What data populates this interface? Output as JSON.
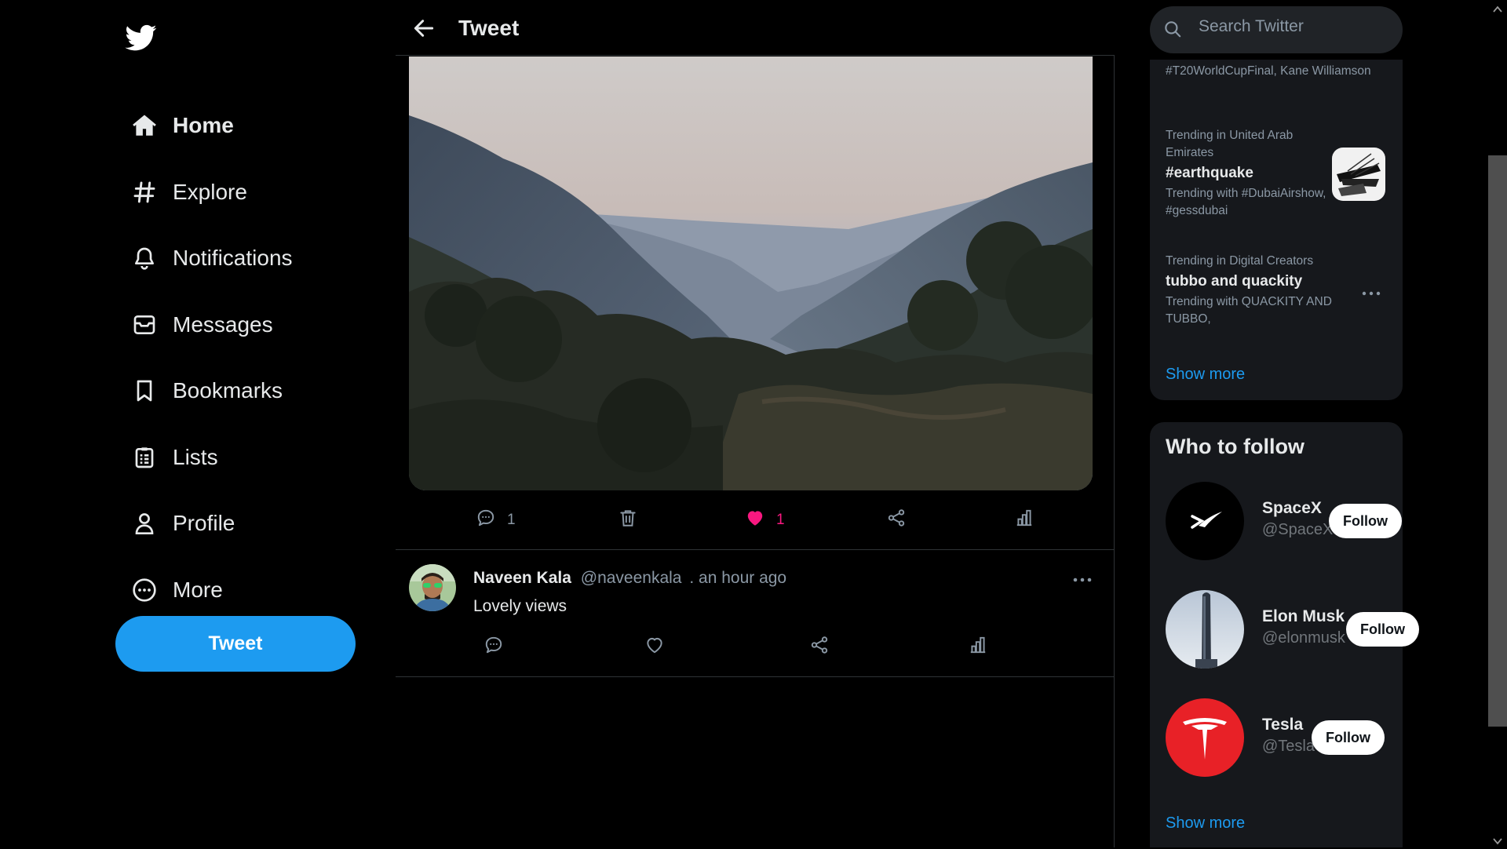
{
  "nav": {
    "items": [
      {
        "label": "Home",
        "icon": "home-icon"
      },
      {
        "label": "Explore",
        "icon": "hashtag-icon"
      },
      {
        "label": "Notifications",
        "icon": "bell-icon"
      },
      {
        "label": "Messages",
        "icon": "mail-icon"
      },
      {
        "label": "Bookmarks",
        "icon": "bookmark-icon"
      },
      {
        "label": "Lists",
        "icon": "list-icon"
      },
      {
        "label": "Profile",
        "icon": "user-icon"
      },
      {
        "label": "More",
        "icon": "more-circle-icon"
      }
    ],
    "tweet_button": "Tweet"
  },
  "header": {
    "title": "Tweet"
  },
  "main_tweet": {
    "reply_count": "1",
    "like_count": "1"
  },
  "reply": {
    "name": "Naveen Kala",
    "handle": "@naveenkala",
    "time": ". an hour ago",
    "text": "Lovely views"
  },
  "search": {
    "placeholder": "Search Twitter"
  },
  "trends": {
    "partial_text": "#T20WorldCupFinal, Kane Williamson",
    "items": [
      {
        "context": "Trending in United Arab Emirates",
        "title": "#earthquake",
        "detail": "Trending with #DubaiAirshow, #gessdubai"
      },
      {
        "context": "Trending in Digital Creators",
        "title": "tubbo and quackity",
        "detail": "Trending with QUACKITY AND TUBBO,"
      }
    ],
    "show_more": "Show more"
  },
  "who_to_follow": {
    "title": "Who to follow",
    "accounts": [
      {
        "name": "SpaceX",
        "handle": "@SpaceX",
        "button": "Follow"
      },
      {
        "name": "Elon Musk",
        "handle": "@elonmusk",
        "button": "Follow"
      },
      {
        "name": "Tesla",
        "handle": "@Tesla",
        "button": "Follow"
      }
    ],
    "show_more": "Show more"
  },
  "colors": {
    "accent": "#1d9bf0",
    "like": "#f91880",
    "background": "#000000",
    "panel": "#16181c"
  }
}
